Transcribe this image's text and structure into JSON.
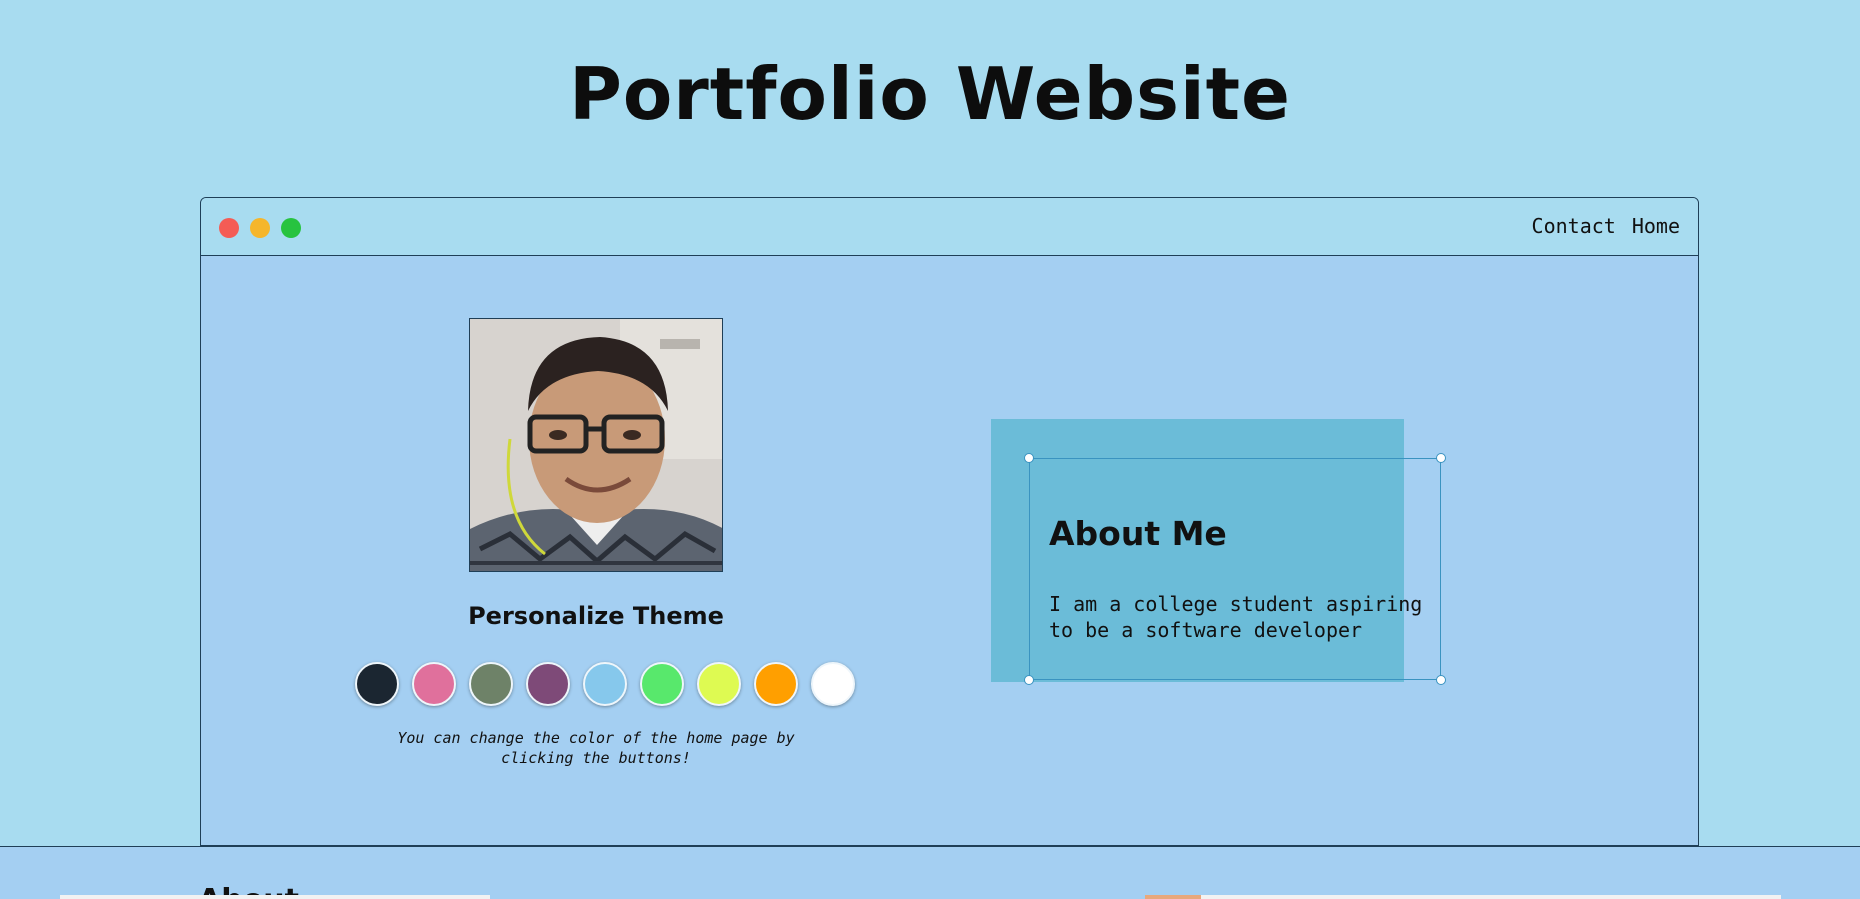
{
  "site": {
    "title": "Portfolio Website"
  },
  "window": {
    "nav": [
      {
        "label": "Contact"
      },
      {
        "label": "Home"
      }
    ]
  },
  "profile": {
    "photo_alt": "profile photo"
  },
  "theme": {
    "title": "Personalize Theme",
    "swatches": [
      "#1b2631",
      "#e0709c",
      "#6e8268",
      "#7e4a78",
      "#86c8ec",
      "#58e86c",
      "#defa52",
      "#ff9f00",
      "#ffffff"
    ],
    "hint": "You can change the color of the home page by clicking the buttons!"
  },
  "about": {
    "title": "About Me",
    "text": "I am a college student aspiring to be a software developer"
  },
  "next_section": {
    "heading": "About"
  }
}
